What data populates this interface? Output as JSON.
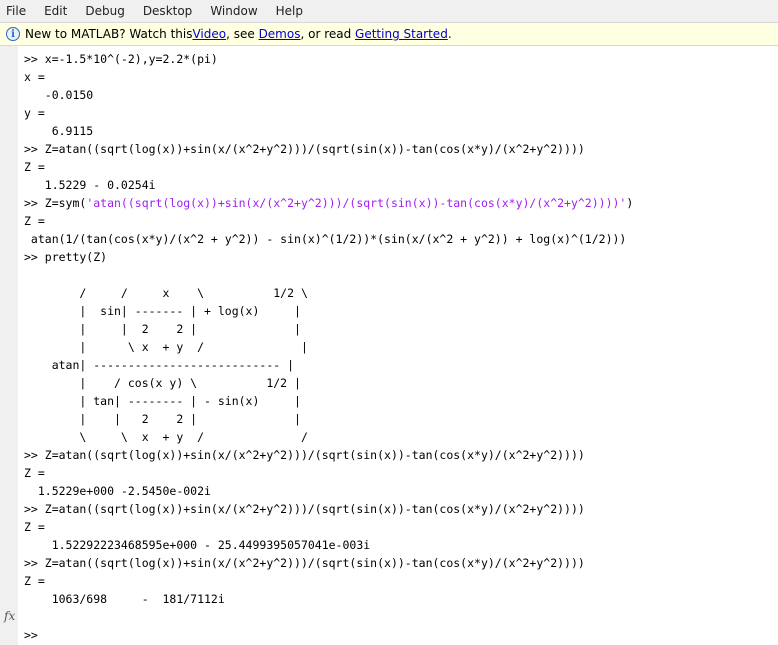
{
  "menu": [
    "File",
    "Edit",
    "Debug",
    "Desktop",
    "Window",
    "Help"
  ],
  "info_bar": {
    "icon": "info-icon",
    "prefix": "New to MATLAB? Watch this ",
    "link_video": "Video",
    "sep1": ", see ",
    "link_demos": "Demos",
    "sep2": ", or read ",
    "link_getting_started": "Getting Started",
    "suffix": "."
  },
  "console": {
    "l01": ">> x=-1.5*10^(-2),y=2.2*(pi)",
    "l02": "x =",
    "l03": "   -0.0150",
    "l04": "y =",
    "l05": "    6.9115",
    "l06": ">> Z=atan((sqrt(log(x))+sin(x/(x^2+y^2)))/(sqrt(sin(x))-tan(cos(x*y)/(x^2+y^2))))",
    "l07": "Z =",
    "l08": "   1.5229 - 0.0254i",
    "l09_pre": ">> Z=sym(",
    "l09_str": "'atan((sqrt(log(x))+sin(x/(x^2+y^2)))/(sqrt(sin(x))-tan(cos(x*y)/(x^2+y^2))))'",
    "l09_post": ")",
    "l10": "Z =",
    "l11": " atan(1/(tan(cos(x*y)/(x^2 + y^2)) - sin(x)^(1/2))*(sin(x/(x^2 + y^2)) + log(x)^(1/2)))",
    "l12": ">> pretty(Z)",
    "p1": "        /     /     x    \\          1/2 \\",
    "p2": "        |  sin| ------- | + log(x)     |",
    "p3": "        |     |  2    2 |              |",
    "p4": "        |      \\ x  + y  /              |",
    "p5": "    atan| --------------------------- |",
    "p6": "        |    / cos(x y) \\          1/2 |",
    "p7": "        | tan| -------- | - sin(x)     |",
    "p8": "        |    |   2    2 |              |",
    "p9": "        \\     \\  x  + y  /              /",
    "l13": ">> Z=atan((sqrt(log(x))+sin(x/(x^2+y^2)))/(sqrt(sin(x))-tan(cos(x*y)/(x^2+y^2))))",
    "l14": "Z =",
    "l15": "  1.5229e+000 -2.5450e-002i",
    "l16": ">> Z=atan((sqrt(log(x))+sin(x/(x^2+y^2)))/(sqrt(sin(x))-tan(cos(x*y)/(x^2+y^2))))",
    "l17": "Z =",
    "l18": "    1.52292223468595e+000 - 25.4499395057041e-003i",
    "l19": ">> Z=atan((sqrt(log(x))+sin(x/(x^2+y^2)))/(sqrt(sin(x))-tan(cos(x*y)/(x^2+y^2))))",
    "l20": "Z =",
    "l21": "    1063/698     -  181/7112i",
    "prompt": ">> "
  },
  "fx_label": "fx",
  "colors": {
    "string": "#a020f0",
    "link": "#0000cc",
    "info_bg": "#ffffe1"
  }
}
